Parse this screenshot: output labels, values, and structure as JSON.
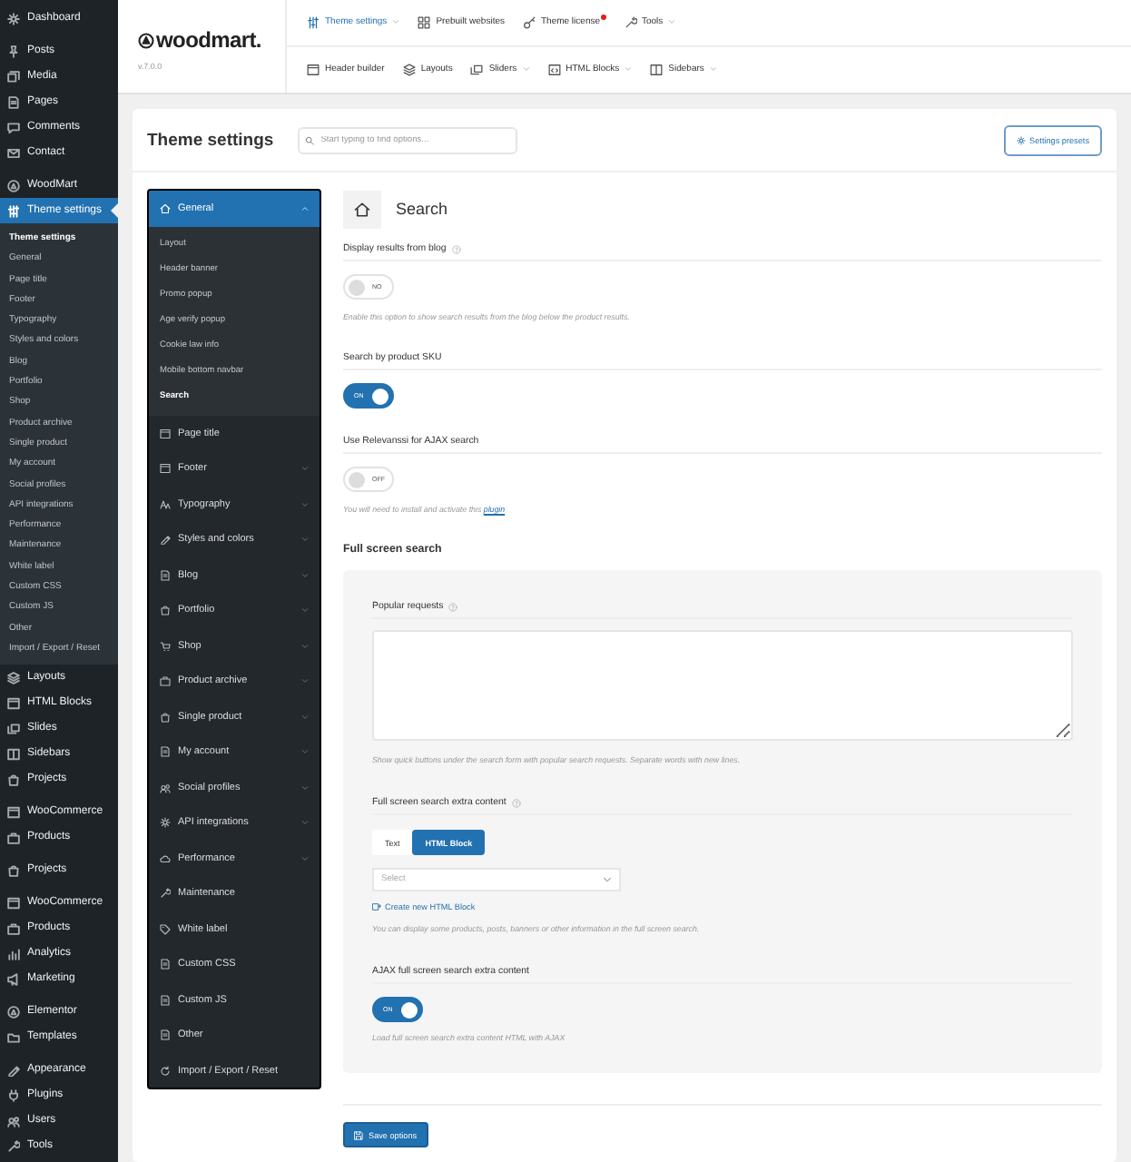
{
  "admin_menu": [
    {
      "items": [
        {
          "label": "Dashboard",
          "selected": false
        }
      ]
    },
    {
      "items": [
        {
          "label": "Posts",
          "selected": false
        },
        {
          "label": "Media",
          "selected": false
        },
        {
          "label": "Pages",
          "selected": false
        },
        {
          "label": "Comments",
          "selected": false
        },
        {
          "label": "Contact",
          "selected": false
        }
      ]
    },
    {
      "items": [
        {
          "label": "WoodMart",
          "selected": false
        },
        {
          "label": "Theme settings",
          "selected": true,
          "children": [
            {
              "label": "Theme settings",
              "selected": true
            },
            {
              "label": "General",
              "selected": false
            },
            {
              "label": "Page title",
              "selected": false
            },
            {
              "label": "Footer",
              "selected": false
            },
            {
              "label": "Typography",
              "selected": false
            },
            {
              "label": "Styles and colors",
              "selected": false
            },
            {
              "label": "Blog",
              "selected": false
            },
            {
              "label": "Portfolio",
              "selected": false
            },
            {
              "label": "Shop",
              "selected": false
            },
            {
              "label": "Product archive",
              "selected": false
            },
            {
              "label": "Single product",
              "selected": false
            },
            {
              "label": "My account",
              "selected": false
            },
            {
              "label": "Social profiles",
              "selected": false
            },
            {
              "label": "API integrations",
              "selected": false
            },
            {
              "label": "Performance",
              "selected": false
            },
            {
              "label": "Maintenance",
              "selected": false
            },
            {
              "label": "White label",
              "selected": false
            },
            {
              "label": "Custom CSS",
              "selected": false
            },
            {
              "label": "Custom JS",
              "selected": false
            },
            {
              "label": "Other",
              "selected": false
            },
            {
              "label": "Import / Export / Reset",
              "selected": false
            }
          ]
        },
        {
          "label": "Layouts",
          "selected": false
        },
        {
          "label": "HTML Blocks",
          "selected": false
        },
        {
          "label": "Slides",
          "selected": false
        },
        {
          "label": "Sidebars",
          "selected": false
        },
        {
          "label": "Projects",
          "selected": false
        }
      ]
    },
    {
      "items": [
        {
          "label": "WooCommerce",
          "selected": false
        },
        {
          "label": "Products",
          "selected": false
        }
      ]
    },
    {
      "items": [
        {
          "label": "Projects",
          "selected": false
        }
      ]
    },
    {
      "items": [
        {
          "label": "WooCommerce",
          "selected": false
        },
        {
          "label": "Products",
          "selected": false
        },
        {
          "label": "Analytics",
          "selected": false
        },
        {
          "label": "Marketing",
          "selected": false
        }
      ]
    },
    {
      "items": [
        {
          "label": "Elementor",
          "selected": false
        },
        {
          "label": "Templates",
          "selected": false
        }
      ]
    },
    {
      "items": [
        {
          "label": "Appearance",
          "selected": false
        },
        {
          "label": "Plugins",
          "selected": false
        },
        {
          "label": "Users",
          "selected": false
        },
        {
          "label": "Tools",
          "selected": false
        }
      ]
    }
  ],
  "header": {
    "logo": "woodmart.",
    "version": "v.7.0.0",
    "nav_rows": [
      [
        {
          "label": "Theme settings",
          "selected": true,
          "dropdown": true,
          "notification": false
        },
        {
          "label": "Prebuilt websites",
          "selected": false,
          "dropdown": false,
          "notification": false
        },
        {
          "label": "Theme license",
          "selected": false,
          "dropdown": false,
          "notification": true
        },
        {
          "label": "Tools",
          "selected": false,
          "dropdown": true,
          "notification": false
        }
      ],
      [
        {
          "label": "Header builder",
          "selected": false,
          "dropdown": false,
          "notification": false
        },
        {
          "label": "Layouts",
          "selected": false,
          "dropdown": false,
          "notification": false
        },
        {
          "label": "Sliders",
          "selected": false,
          "dropdown": true,
          "notification": false
        },
        {
          "label": "HTML Blocks",
          "selected": false,
          "dropdown": true,
          "notification": false
        },
        {
          "label": "Sidebars",
          "selected": false,
          "dropdown": true,
          "notification": false
        }
      ]
    ]
  },
  "page": {
    "title": "Theme settings",
    "search_placeholder": "Start typing to find options...",
    "presets_button": "Settings presets"
  },
  "settings_nav": [
    {
      "label": "General",
      "selected": true,
      "expandable": true,
      "expanded": true,
      "children": [
        {
          "label": "Layout",
          "selected": false
        },
        {
          "label": "Header banner",
          "selected": false
        },
        {
          "label": "Promo popup",
          "selected": false
        },
        {
          "label": "Age verify popup",
          "selected": false
        },
        {
          "label": "Cookie law info",
          "selected": false
        },
        {
          "label": "Mobile bottom navbar",
          "selected": false
        },
        {
          "label": "Search",
          "selected": true
        }
      ]
    },
    {
      "label": "Page title",
      "selected": false,
      "expandable": false,
      "expanded": false
    },
    {
      "label": "Footer",
      "selected": false,
      "expandable": true,
      "expanded": false
    },
    {
      "label": "Typography",
      "selected": false,
      "expandable": true,
      "expanded": false
    },
    {
      "label": "Styles and colors",
      "selected": false,
      "expandable": true,
      "expanded": false
    },
    {
      "label": "Blog",
      "selected": false,
      "expandable": true,
      "expanded": false
    },
    {
      "label": "Portfolio",
      "selected": false,
      "expandable": true,
      "expanded": false
    },
    {
      "label": "Shop",
      "selected": false,
      "expandable": true,
      "expanded": false
    },
    {
      "label": "Product archive",
      "selected": false,
      "expandable": true,
      "expanded": false
    },
    {
      "label": "Single product",
      "selected": false,
      "expandable": true,
      "expanded": false
    },
    {
      "label": "My account",
      "selected": false,
      "expandable": true,
      "expanded": false
    },
    {
      "label": "Social profiles",
      "selected": false,
      "expandable": true,
      "expanded": false
    },
    {
      "label": "API integrations",
      "selected": false,
      "expandable": true,
      "expanded": false
    },
    {
      "label": "Performance",
      "selected": false,
      "expandable": true,
      "expanded": false
    },
    {
      "label": "Maintenance",
      "selected": false,
      "expandable": false,
      "expanded": false
    },
    {
      "label": "White label",
      "selected": false,
      "expandable": false,
      "expanded": false
    },
    {
      "label": "Custom CSS",
      "selected": false,
      "expandable": false,
      "expanded": false
    },
    {
      "label": "Custom JS",
      "selected": false,
      "expandable": false,
      "expanded": false
    },
    {
      "label": "Other",
      "selected": false,
      "expandable": false,
      "expanded": false
    },
    {
      "label": "Import / Export / Reset",
      "selected": false,
      "expandable": false,
      "expanded": false
    }
  ],
  "section": {
    "title": "Search",
    "fields": [
      {
        "kind": "switch",
        "label": "Display results from blog",
        "help": true,
        "on": false,
        "switch_text": "NO",
        "description": "Enable this option to show search results from the blog below the product results."
      },
      {
        "kind": "switch",
        "label": "Search by product SKU",
        "help": false,
        "on": true,
        "switch_text": "ON"
      },
      {
        "kind": "switch",
        "label": "Use Relevanssi for AJAX search",
        "help": false,
        "on": false,
        "switch_text": "OFF",
        "description": "You will need to install and activate this",
        "link": "plugin"
      }
    ],
    "subheading": "Full screen search",
    "panel_fields": [
      {
        "kind": "textarea",
        "label": "Popular requests",
        "help": true,
        "description": "Show quick buttons under the search form with popular search requests. Separate words with new lines."
      },
      {
        "kind": "button_set",
        "label": "Full screen search extra content",
        "help": true,
        "options": [
          {
            "label": "Text",
            "selected": false
          },
          {
            "label": "HTML Block",
            "selected": true
          }
        ],
        "select_placeholder": "Select",
        "link": "Create new HTML Block",
        "description": "You can display some products, posts, banners or other information in the full screen search."
      },
      {
        "kind": "switch",
        "label": "AJAX full screen search extra content",
        "help": false,
        "on": true,
        "switch_text": "ON",
        "description": "Load full screen search extra content HTML with AJAX"
      }
    ]
  },
  "save_button": "Save options"
}
